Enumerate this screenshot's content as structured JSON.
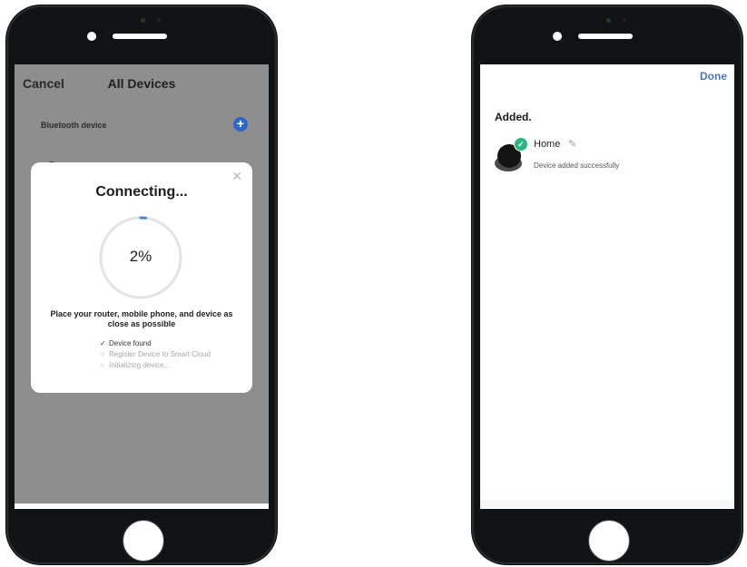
{
  "left_screen": {
    "nav": {
      "cancel_label": "Cancel",
      "title": "All Devices"
    },
    "bluetooth_row": {
      "label": "Bluetooth device",
      "add_icon": "plus-icon"
    },
    "modal": {
      "title": "Connecting...",
      "progress_percent": 2,
      "progress_label": "2%",
      "instruction": "Place your router, mobile phone, and device as close as possible",
      "steps": [
        {
          "label": "Device found",
          "status": "done"
        },
        {
          "label": "Register Device to Smart Cloud",
          "status": "pending"
        },
        {
          "label": "Initializing device...",
          "status": "pending"
        }
      ],
      "close_icon": "close-icon"
    }
  },
  "right_screen": {
    "nav": {
      "done_label": "Done"
    },
    "heading": "Added.",
    "device": {
      "name": "Home",
      "status": "Device added successfully",
      "edit_icon": "pencil-icon",
      "badge_icon": "check-icon"
    }
  },
  "colors": {
    "accent_blue": "#2f67c8",
    "done_blue": "#4a78b5",
    "success_green": "#2cb57e",
    "progress_blue": "#4a86c8",
    "overlay_gray": "#8e8e8e"
  }
}
